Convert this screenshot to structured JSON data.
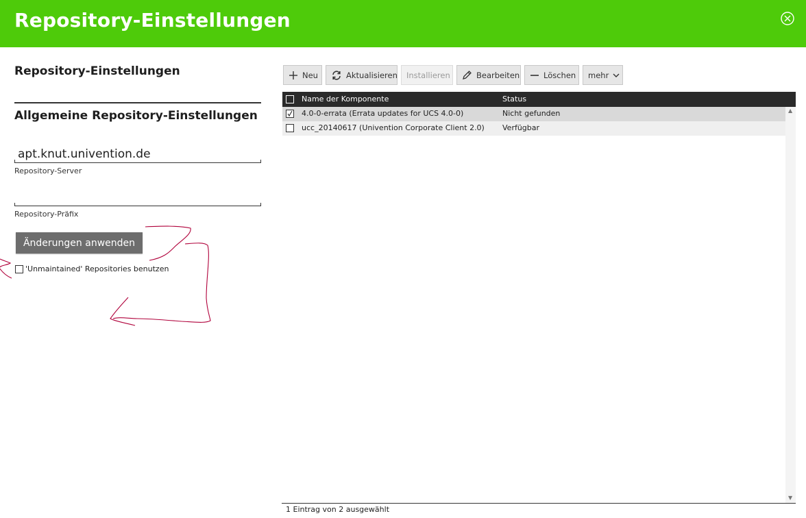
{
  "dialog": {
    "title": "Repository-Einstellungen"
  },
  "left": {
    "section_title": "Repository-Einstellungen",
    "subsection_title": "Allgemeine Repository-Einstellungen",
    "server_value": "apt.knut.univention.de",
    "server_label": "Repository-Server",
    "prefix_value": "",
    "prefix_label": "Repository-Präfix",
    "apply_button": "Änderungen anwenden",
    "unmaintained_label": "'Unmaintained' Repositories benutzen",
    "unmaintained_checked": false
  },
  "toolbar": {
    "new": "Neu",
    "refresh": "Aktualisieren",
    "install": "Installieren",
    "edit": "Bearbeiten",
    "delete": "Löschen",
    "more": "mehr"
  },
  "grid": {
    "columns": [
      "Name der Komponente",
      "Status"
    ],
    "rows": [
      {
        "name": "4.0-0-errata (Errata updates for UCS 4.0-0)",
        "status": "Nicht gefunden",
        "selected": true
      },
      {
        "name": "ucc_20140617 (Univention Corporate Client 2.0)",
        "status": "Verfügbar",
        "selected": false
      }
    ],
    "footer": "1 Eintrag von 2 ausgewählt"
  },
  "colors": {
    "header_bg": "#4ecb0a",
    "apply_bg": "#6d6d6d",
    "annotation": "#b0003a"
  }
}
